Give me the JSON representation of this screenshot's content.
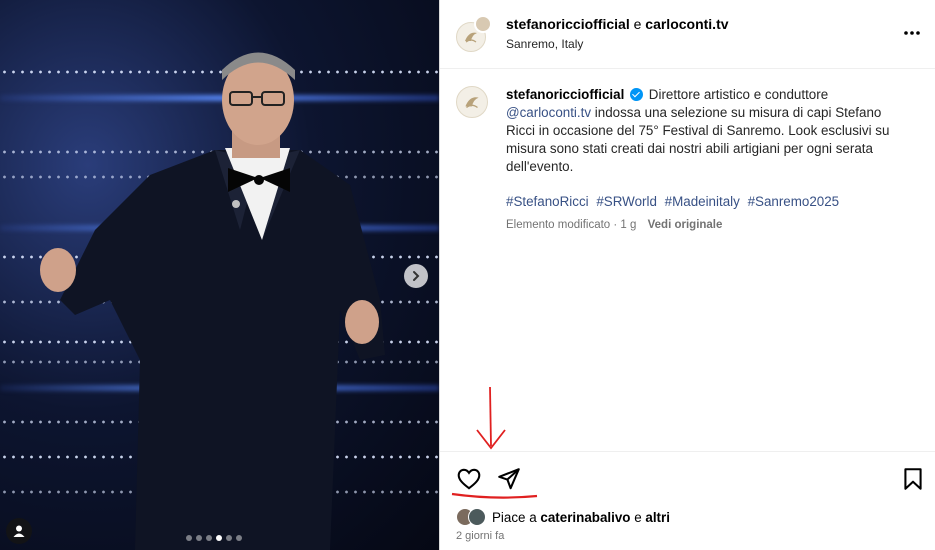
{
  "header": {
    "account_primary": "stefanoricciofficial",
    "joiner": "e",
    "account_secondary": "carloconti.tv",
    "location": "Sanremo, Italy"
  },
  "caption": {
    "username": "stefanoricciofficial",
    "text_before_mention": "Direttore artistico e conduttore",
    "mention": "@carloconti.tv",
    "text_after_mention": "indossa una selezione su misura di capi Stefano Ricci in occasione del 75° Festival di Sanremo. Look esclusivi su misura sono stati creati dai nostri abili artigiani per ogni serata dell'evento.",
    "hashtags": [
      "#StefanoRicci",
      "#SRWorld",
      "#Madeinitaly",
      "#Sanremo2025"
    ],
    "edited_label": "Elemento modificato",
    "edited_time": "· 1 g",
    "view_original": "Vedi originale"
  },
  "likes": {
    "prefix": "Piace a",
    "user": "caterinabalivo",
    "joiner": "e",
    "others": "altri"
  },
  "time_ago": "2 giorni fa",
  "carousel": {
    "total": 6,
    "active": 4
  },
  "icons": {
    "like": "heart-icon",
    "share": "paper-plane-icon",
    "save": "bookmark-icon",
    "more": "more-horizontal-icon",
    "next": "chevron-right-icon",
    "tag": "user-tag-icon"
  },
  "colors": {
    "verified": "#0095f6",
    "link": "#385185",
    "annotation": "#e02020"
  }
}
